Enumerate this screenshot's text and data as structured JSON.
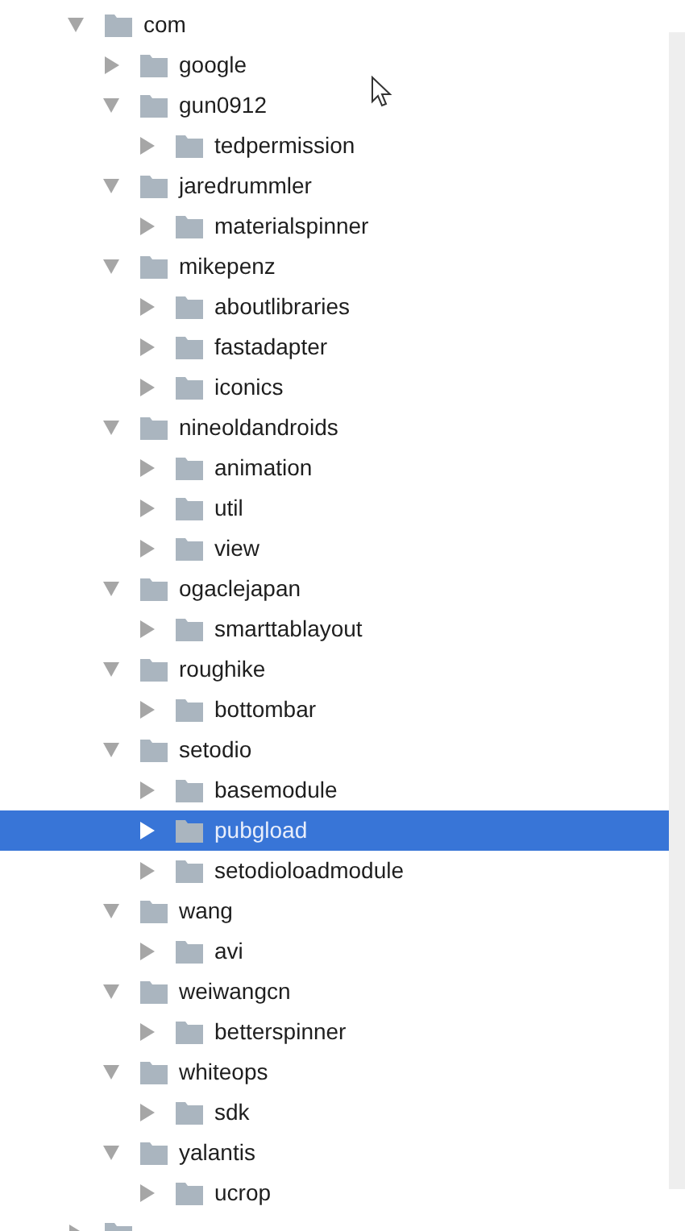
{
  "tree": [
    {
      "label": "com",
      "expanded": true,
      "selected": false,
      "children": [
        {
          "label": "google",
          "expanded": false,
          "selected": false
        },
        {
          "label": "gun0912",
          "expanded": true,
          "selected": false,
          "children": [
            {
              "label": "tedpermission",
              "expanded": false,
              "selected": false
            }
          ]
        },
        {
          "label": "jaredrummler",
          "expanded": true,
          "selected": false,
          "children": [
            {
              "label": "materialspinner",
              "expanded": false,
              "selected": false
            }
          ]
        },
        {
          "label": "mikepenz",
          "expanded": true,
          "selected": false,
          "children": [
            {
              "label": "aboutlibraries",
              "expanded": false,
              "selected": false
            },
            {
              "label": "fastadapter",
              "expanded": false,
              "selected": false
            },
            {
              "label": "iconics",
              "expanded": false,
              "selected": false
            }
          ]
        },
        {
          "label": "nineoldandroids",
          "expanded": true,
          "selected": false,
          "children": [
            {
              "label": "animation",
              "expanded": false,
              "selected": false
            },
            {
              "label": "util",
              "expanded": false,
              "selected": false
            },
            {
              "label": "view",
              "expanded": false,
              "selected": false
            }
          ]
        },
        {
          "label": "ogaclejapan",
          "expanded": true,
          "selected": false,
          "children": [
            {
              "label": "smarttablayout",
              "expanded": false,
              "selected": false
            }
          ]
        },
        {
          "label": "roughike",
          "expanded": true,
          "selected": false,
          "children": [
            {
              "label": "bottombar",
              "expanded": false,
              "selected": false
            }
          ]
        },
        {
          "label": "setodio",
          "expanded": true,
          "selected": false,
          "children": [
            {
              "label": "basemodule",
              "expanded": false,
              "selected": false
            },
            {
              "label": "pubgload",
              "expanded": false,
              "selected": true
            },
            {
              "label": "setodioloadmodule",
              "expanded": false,
              "selected": false
            }
          ]
        },
        {
          "label": "wang",
          "expanded": true,
          "selected": false,
          "children": [
            {
              "label": "avi",
              "expanded": false,
              "selected": false
            }
          ]
        },
        {
          "label": "weiwangcn",
          "expanded": true,
          "selected": false,
          "children": [
            {
              "label": "betterspinner",
              "expanded": false,
              "selected": false
            }
          ]
        },
        {
          "label": "whiteops",
          "expanded": true,
          "selected": false,
          "children": [
            {
              "label": "sdk",
              "expanded": false,
              "selected": false
            }
          ]
        },
        {
          "label": "yalantis",
          "expanded": true,
          "selected": false,
          "children": [
            {
              "label": "ucrop",
              "expanded": false,
              "selected": false
            }
          ]
        }
      ]
    },
    {
      "expanded": false,
      "selected": false
    }
  ]
}
